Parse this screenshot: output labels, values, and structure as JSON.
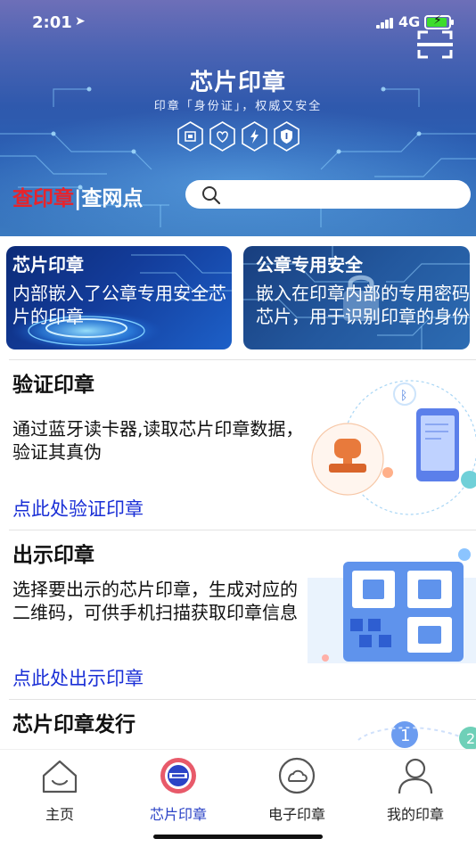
{
  "status": {
    "time": "2:01",
    "network": "4G"
  },
  "banner": {
    "title": "芯片印章",
    "subtitle": "印章「身份证」，权威又安全",
    "feature_icons": [
      "chip-icon",
      "heart-shield-icon",
      "lightning-icon",
      "shield-icon"
    ]
  },
  "query": {
    "tab_stamp": "查印章",
    "separator": "|",
    "tab_outlet": "查网点",
    "search_placeholder": ""
  },
  "cards": [
    {
      "title": "芯片印章",
      "desc": "内部嵌入了公章专用安全芯片的印章"
    },
    {
      "title": "公章专用安全",
      "desc": "嵌入在印章内部的专用密码芯片，用于识别印章的身份"
    }
  ],
  "sections": [
    {
      "title": "验证印章",
      "desc": "通过蓝牙读卡器,读取芯片印章数据，验证其真伪",
      "link": "点此处验证印章"
    },
    {
      "title": "出示印章",
      "desc": "选择要出示的芯片印章，生成对应的二维码，可供手机扫描获取印章信息",
      "link": "点此处出示印章"
    },
    {
      "title": "芯片印章发行",
      "desc": "",
      "link": ""
    }
  ],
  "tabbar": {
    "active": "芯片印章",
    "items": [
      {
        "label": "主页",
        "icon": "home-icon"
      },
      {
        "label": "芯片印章",
        "icon": "chip-seal-icon"
      },
      {
        "label": "电子印章",
        "icon": "cloud-icon"
      },
      {
        "label": "我的印章",
        "icon": "user-icon"
      }
    ]
  },
  "colors": {
    "brand_blue": "#2b43c6",
    "link_blue": "#1a2fd6",
    "stamp_red": "#e8232a"
  }
}
